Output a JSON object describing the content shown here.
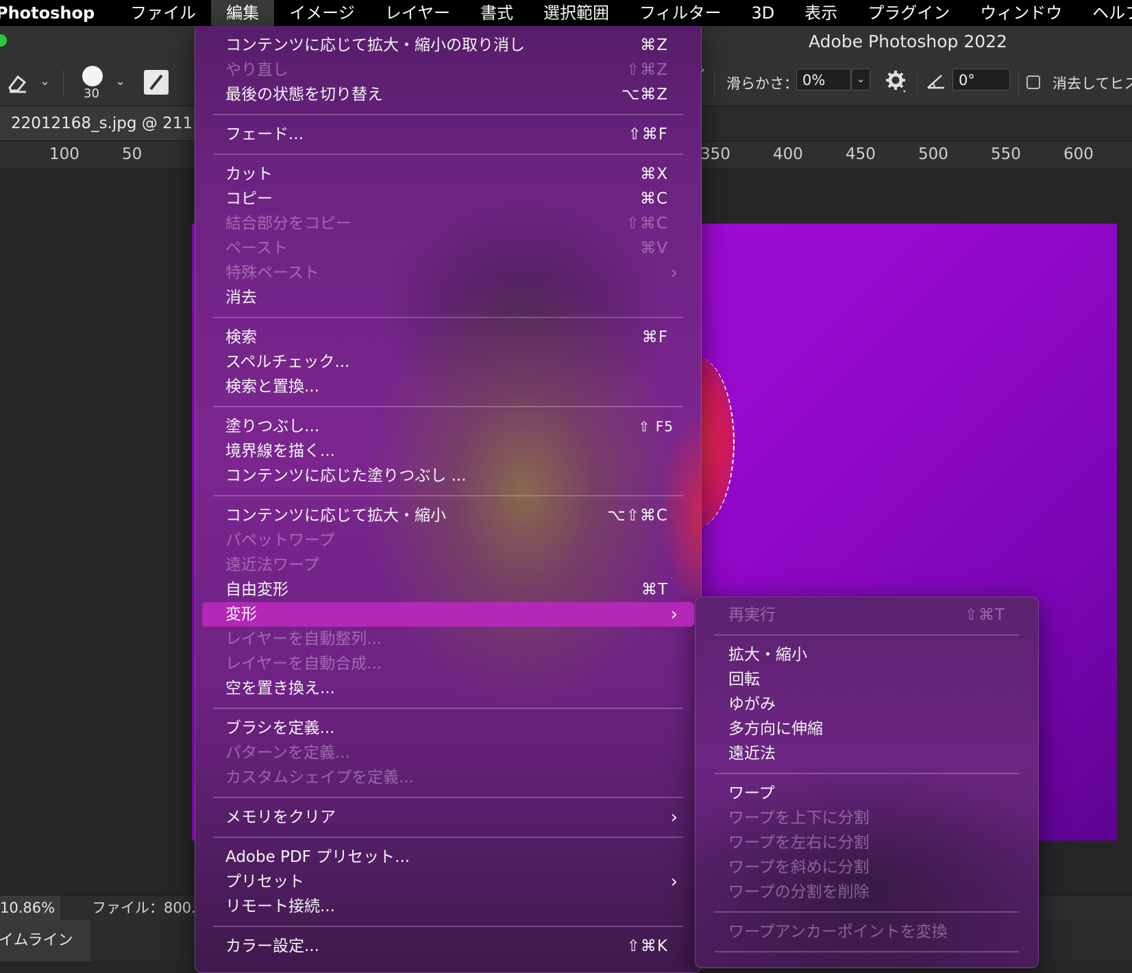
{
  "menubar": {
    "app": "Photoshop",
    "items": [
      "ファイル",
      "編集",
      "イメージ",
      "レイヤー",
      "書式",
      "選択範囲",
      "フィルター",
      "3D",
      "表示",
      "プラグイン",
      "ウィンドウ",
      "ヘルプ"
    ]
  },
  "title": "Adobe Photoshop 2022",
  "options": {
    "brush_size": "30",
    "smoothing_label": "滑らかさ：",
    "smoothing_value": "0%",
    "angle_value": "0°",
    "erase_history_label": "消去してヒス"
  },
  "document_tab": "22012168_s.jpg @ 211",
  "ruler": {
    "left": [
      "100",
      "50"
    ],
    "right": [
      "350",
      "400",
      "450",
      "500",
      "550",
      "600"
    ]
  },
  "status": {
    "zoom": "10.86%",
    "file_info": "ファイル：800."
  },
  "timeline_tab": "タイムライン",
  "edit_menu": {
    "undo": {
      "label": "コンテンツに応じて拡大・縮小の取り消し",
      "shortcut": "⌘Z"
    },
    "redo": {
      "label": "やり直し",
      "shortcut": "⇧⌘Z"
    },
    "toggle_last": {
      "label": "最後の状態を切り替え",
      "shortcut": "⌥⌘Z"
    },
    "fade": {
      "label": "フェード...",
      "shortcut": "⇧⌘F"
    },
    "cut": {
      "label": "カット",
      "shortcut": "⌘X"
    },
    "copy": {
      "label": "コピー",
      "shortcut": "⌘C"
    },
    "copy_merged": {
      "label": "結合部分をコピー",
      "shortcut": "⇧⌘C"
    },
    "paste": {
      "label": "ペースト",
      "shortcut": "⌘V"
    },
    "paste_special": {
      "label": "特殊ペースト"
    },
    "clear": {
      "label": "消去"
    },
    "search": {
      "label": "検索",
      "shortcut": "⌘F"
    },
    "spell_check": {
      "label": "スペルチェック..."
    },
    "find_replace": {
      "label": "検索と置換..."
    },
    "fill": {
      "label": "塗りつぶし...",
      "shortcut": "⇧ F5"
    },
    "stroke": {
      "label": "境界線を描く..."
    },
    "content_aware_fill": {
      "label": "コンテンツに応じた塗りつぶし ..."
    },
    "content_aware_scale": {
      "label": "コンテンツに応じて拡大・縮小",
      "shortcut": "⌥⇧⌘C"
    },
    "puppet_warp": {
      "label": "パペットワープ"
    },
    "perspective_warp": {
      "label": "遠近法ワープ"
    },
    "free_transform": {
      "label": "自由変形",
      "shortcut": "⌘T"
    },
    "transform": {
      "label": "変形"
    },
    "auto_align": {
      "label": "レイヤーを自動整列..."
    },
    "auto_blend": {
      "label": "レイヤーを自動合成..."
    },
    "sky_replace": {
      "label": "空を置き換え..."
    },
    "define_brush": {
      "label": "ブラシを定義..."
    },
    "define_pattern": {
      "label": "パターンを定義..."
    },
    "define_shape": {
      "label": "カスタムシェイプを定義..."
    },
    "purge": {
      "label": "メモリをクリア"
    },
    "pdf_presets": {
      "label": "Adobe PDF プリセット..."
    },
    "presets": {
      "label": "プリセット"
    },
    "remote": {
      "label": "リモート接続..."
    },
    "color_settings": {
      "label": "カラー設定...",
      "shortcut": "⇧⌘K"
    }
  },
  "transform_menu": {
    "again": {
      "label": "再実行",
      "shortcut": "⇧⌘T"
    },
    "scale": {
      "label": "拡大・縮小"
    },
    "rotate": {
      "label": "回転"
    },
    "skew": {
      "label": "ゆがみ"
    },
    "distort": {
      "label": "多方向に伸縮"
    },
    "perspective": {
      "label": "遠近法"
    },
    "warp": {
      "label": "ワープ"
    },
    "split_horizontal": {
      "label": "ワープを上下に分割"
    },
    "split_vertical": {
      "label": "ワープを左右に分割"
    },
    "split_crosswise": {
      "label": "ワープを斜めに分割"
    },
    "remove_split": {
      "label": "ワープの分割を削除"
    },
    "convert_anchor": {
      "label": "ワープアンカーポイントを変換"
    }
  }
}
